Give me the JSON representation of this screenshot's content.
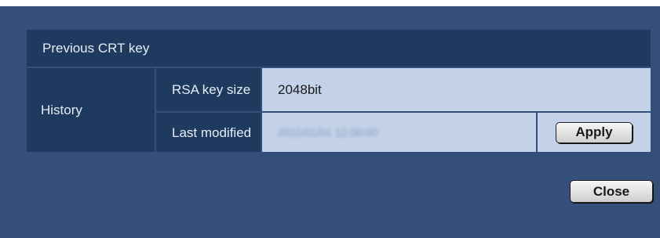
{
  "section": {
    "title": "Previous CRT key",
    "history_label": "History",
    "rsa_key_size_label": "RSA key size",
    "rsa_key_size_value": "2048bit",
    "last_modified_label": "Last modified",
    "last_modified_value": "2011/01/01 12:00:00",
    "apply_label": "Apply"
  },
  "footer": {
    "close_label": "Close"
  }
}
